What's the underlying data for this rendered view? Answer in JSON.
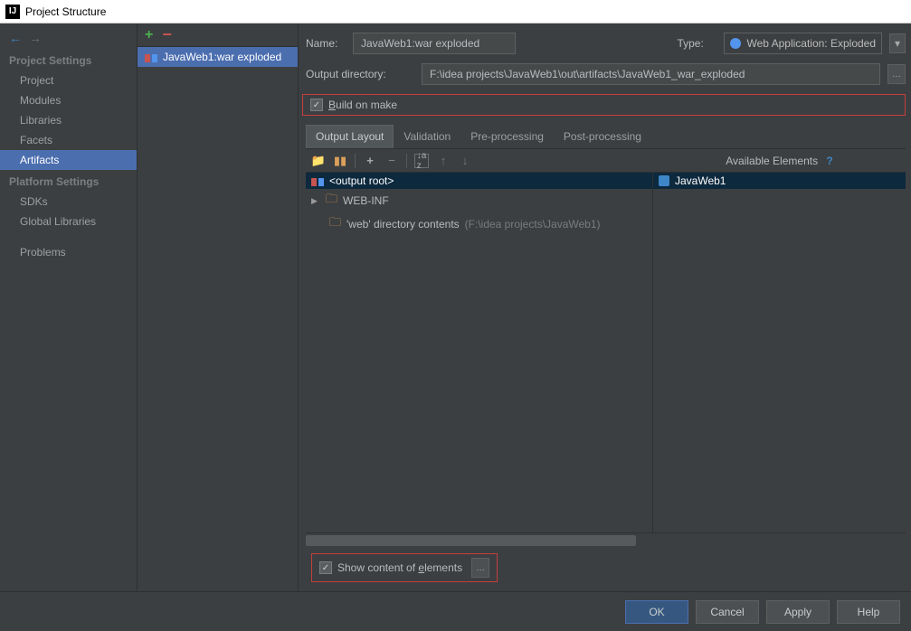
{
  "window": {
    "title": "Project Structure"
  },
  "sidebar": {
    "headings": {
      "project": "Project Settings",
      "platform": "Platform Settings"
    },
    "project_items": [
      "Project",
      "Modules",
      "Libraries",
      "Facets",
      "Artifacts"
    ],
    "platform_items": [
      "SDKs",
      "Global Libraries"
    ],
    "problems": "Problems"
  },
  "artifact_list": {
    "item": "JavaWeb1:war exploded"
  },
  "form": {
    "name_label": "Name:",
    "name_value": "JavaWeb1:war exploded",
    "type_label": "Type:",
    "type_value": "Web Application: Exploded",
    "outdir_label": "Output directory:",
    "outdir_value": "F:\\idea projects\\JavaWeb1\\out\\artifacts\\JavaWeb1_war_exploded",
    "build_on_make": "Build on make"
  },
  "tabs": [
    "Output Layout",
    "Validation",
    "Pre-processing",
    "Post-processing"
  ],
  "available": {
    "header": "Available Elements",
    "module": "JavaWeb1"
  },
  "tree": {
    "root": "<output root>",
    "webinf": "WEB-INF",
    "webdir": "'web' directory contents",
    "webdir_path": "(F:\\idea projects\\JavaWeb1)"
  },
  "show_content": "Show content of elements",
  "buttons": {
    "ok": "OK",
    "cancel": "Cancel",
    "apply": "Apply",
    "help": "Help"
  }
}
